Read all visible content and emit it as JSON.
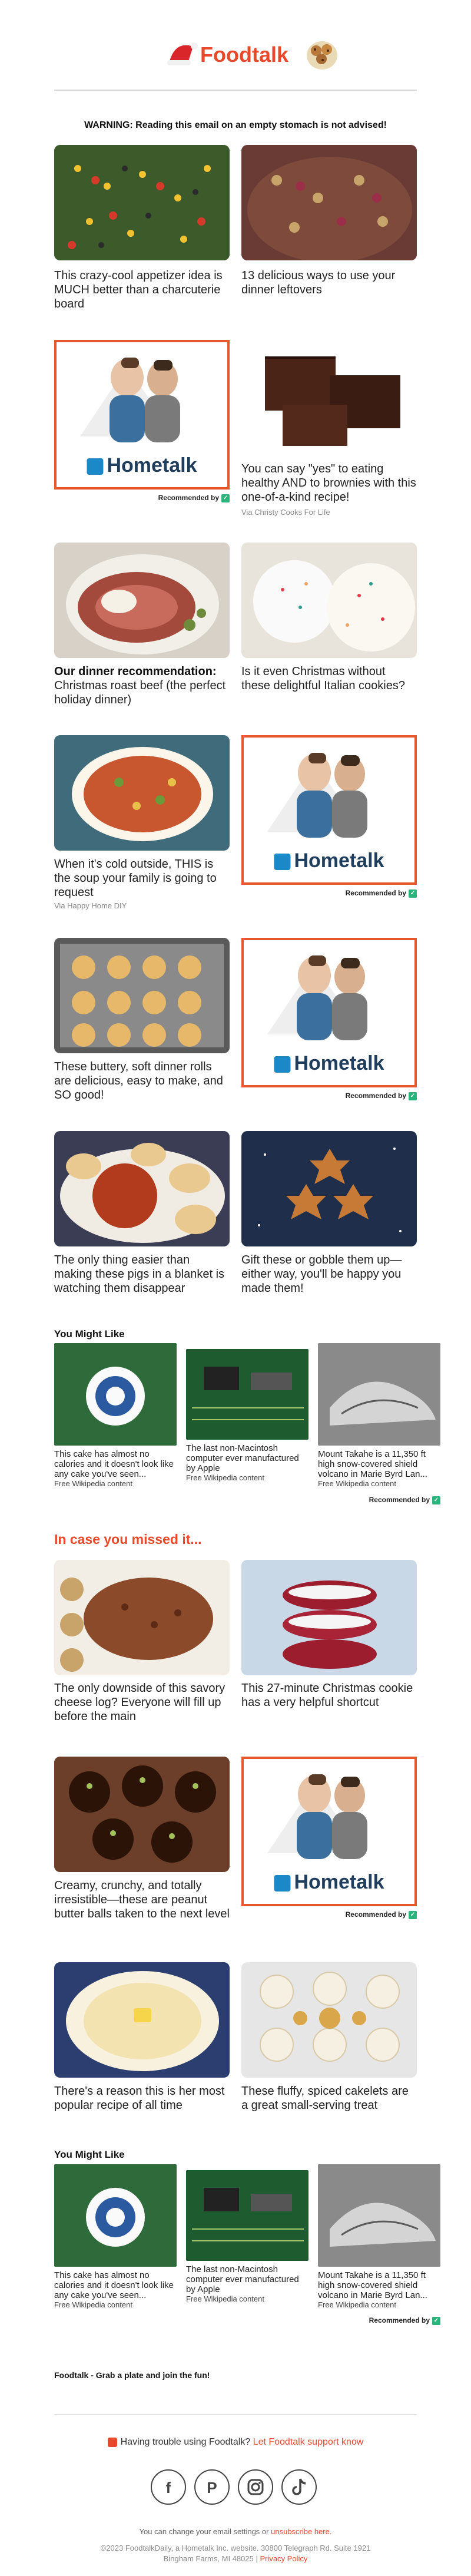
{
  "header": {
    "brand": "Foodtalk",
    "warning": "WARNING: Reading this email on an empty stomach is not advised!"
  },
  "colors": {
    "accent": "#e8492b",
    "ad_border": "#e8572b",
    "hometalk_navy": "#1f3d5c",
    "recommended_green": "#2ab37a"
  },
  "ad": {
    "brand": "Hometalk",
    "icon": "house-icon",
    "recommended_label": "Recommended by"
  },
  "articles": [
    {
      "caption": "This crazy-cool appetizer idea is MUCH better than a charcuterie board"
    },
    {
      "caption": "13 delicious ways to use your dinner leftovers"
    },
    {
      "caption": "You can say \"yes\" to eating healthy AND to brownies with this one-of-a-kind recipe!",
      "via": "Via Christy Cooks For Life"
    },
    {
      "bold": "Our dinner recommendation:",
      "caption": "Christmas roast beef (the perfect holiday dinner)"
    },
    {
      "caption": "Is it even Christmas without these delightful Italian cookies?"
    },
    {
      "caption": "When it's cold outside, THIS is the soup your family is going to request",
      "via": "Via Happy Home DIY"
    },
    {
      "caption": "These buttery, soft dinner rolls are delicious, easy to make, and SO good!"
    },
    {
      "caption": "The only thing easier than making these pigs in a blanket is watching them disappear"
    },
    {
      "caption": "Gift these or gobble them up—either way, you'll be happy you made them!"
    },
    {
      "caption": "The only downside of this savory cheese log? Everyone will fill up before the main"
    },
    {
      "caption": "This 27-minute Christmas cookie has a very helpful shortcut"
    },
    {
      "caption": "Creamy, crunchy, and totally irresistible—these are peanut butter balls taken to the next level"
    },
    {
      "caption": "There's a reason this is her most popular recipe of all time"
    },
    {
      "caption": "These fluffy, spiced cakelets are a great small-serving treat"
    }
  ],
  "you_might_like": {
    "title": "You Might Like",
    "items": [
      {
        "caption": "This cake has almost no calories and it doesn't look like any cake you've seen...",
        "source": "Free Wikipedia content"
      },
      {
        "caption": "The last non-Macintosh computer ever manufactured by Apple",
        "source": "Free Wikipedia content"
      },
      {
        "caption": "Mount Takahe is a 11,350 ft high snow-covered shield volcano in Marie Byrd Lan...",
        "source": "Free Wikipedia content"
      }
    ]
  },
  "missed_title": "In case you missed it...",
  "footer": {
    "tagline": "Foodtalk - Grab a plate and join the fun!",
    "trouble_prefix": "Having trouble using Foodtalk?",
    "trouble_link": "Let Foodtalk support know",
    "social": [
      "facebook-icon",
      "pinterest-icon",
      "instagram-icon",
      "tiktok-icon"
    ],
    "settings_prefix": "You can change your email settings or",
    "unsubscribe": "unsubscribe here.",
    "address_line1": "©2023 FoodtalkDaily, a Hometalk Inc. website. 30800 Telegraph Rd. Suite 1921",
    "address_line2": "Bingham Farms, MI 48025",
    "privacy": "Privacy Policy"
  }
}
